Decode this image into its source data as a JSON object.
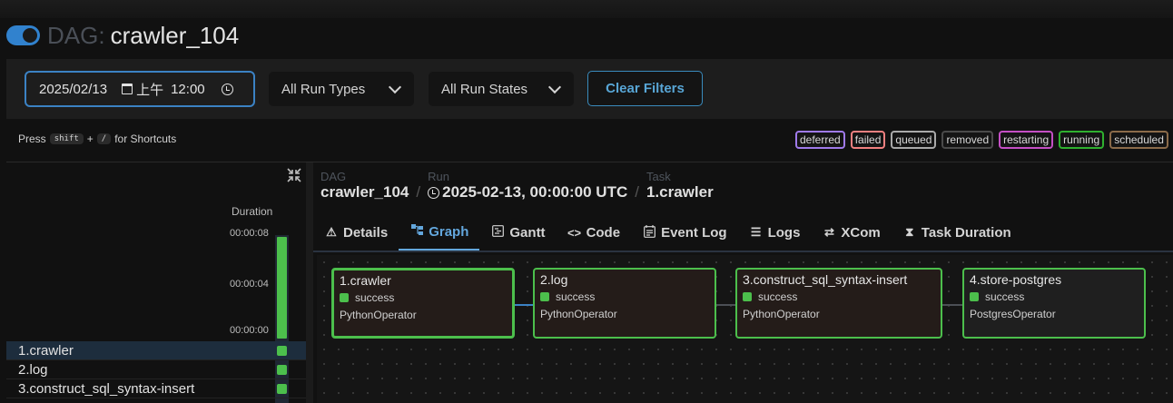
{
  "header": {
    "dag_prefix": "DAG:",
    "dag_id": "crawler_104",
    "toggle_on": true
  },
  "filters": {
    "date": "2025/02/13",
    "time_period": "上午",
    "time": "12:00",
    "run_types": "All Run Types",
    "run_states": "All Run States",
    "clear_label": "Clear Filters"
  },
  "shortcut": {
    "press": "Press",
    "key1": "shift",
    "plus": "+",
    "key2": "/",
    "suffix": "for Shortcuts"
  },
  "legend": [
    {
      "label": "deferred",
      "color": "#9f7aea"
    },
    {
      "label": "failed",
      "color": "#f08080"
    },
    {
      "label": "queued",
      "color": "#a9a9a9"
    },
    {
      "label": "removed",
      "color": "#6b6b6b"
    },
    {
      "label": "restarting",
      "color": "#c44fc4"
    },
    {
      "label": "running",
      "color": "#2fb02f"
    },
    {
      "label": "scheduled",
      "color": "#8b6b4a"
    }
  ],
  "grid": {
    "duration_label": "Duration",
    "ticks": [
      "00:00:08",
      "00:00:04",
      "00:00:00"
    ],
    "run_duration_fraction": 1.0,
    "tasks": [
      "1.crawler",
      "2.log",
      "3.construct_sql_syntax-insert"
    ]
  },
  "details": {
    "dag_label": "DAG",
    "dag_value": "crawler_104",
    "run_label": "Run",
    "run_value": "2025-02-13, 00:00:00 UTC",
    "task_label": "Task",
    "task_value": "1.crawler"
  },
  "tabs": [
    {
      "label": "Details",
      "icon": "warning-icon"
    },
    {
      "label": "Graph",
      "icon": "graph-icon"
    },
    {
      "label": "Gantt",
      "icon": "gantt-icon"
    },
    {
      "label": "Code",
      "icon": "code-icon"
    },
    {
      "label": "Event Log",
      "icon": "event-log-icon"
    },
    {
      "label": "Logs",
      "icon": "logs-icon"
    },
    {
      "label": "XCom",
      "icon": "xcom-icon"
    },
    {
      "label": "Task Duration",
      "icon": "hourglass-icon"
    }
  ],
  "graph_nodes": [
    {
      "name": "1.crawler",
      "state": "success",
      "operator": "PythonOperator"
    },
    {
      "name": "2.log",
      "state": "success",
      "operator": "PythonOperator"
    },
    {
      "name": "3.construct_sql_syntax-insert",
      "state": "success",
      "operator": "PythonOperator"
    },
    {
      "name": "4.store-postgres",
      "state": "success",
      "operator": "PostgresOperator"
    }
  ],
  "colors": {
    "accent": "#3182ce",
    "success": "#4cbf4c"
  }
}
